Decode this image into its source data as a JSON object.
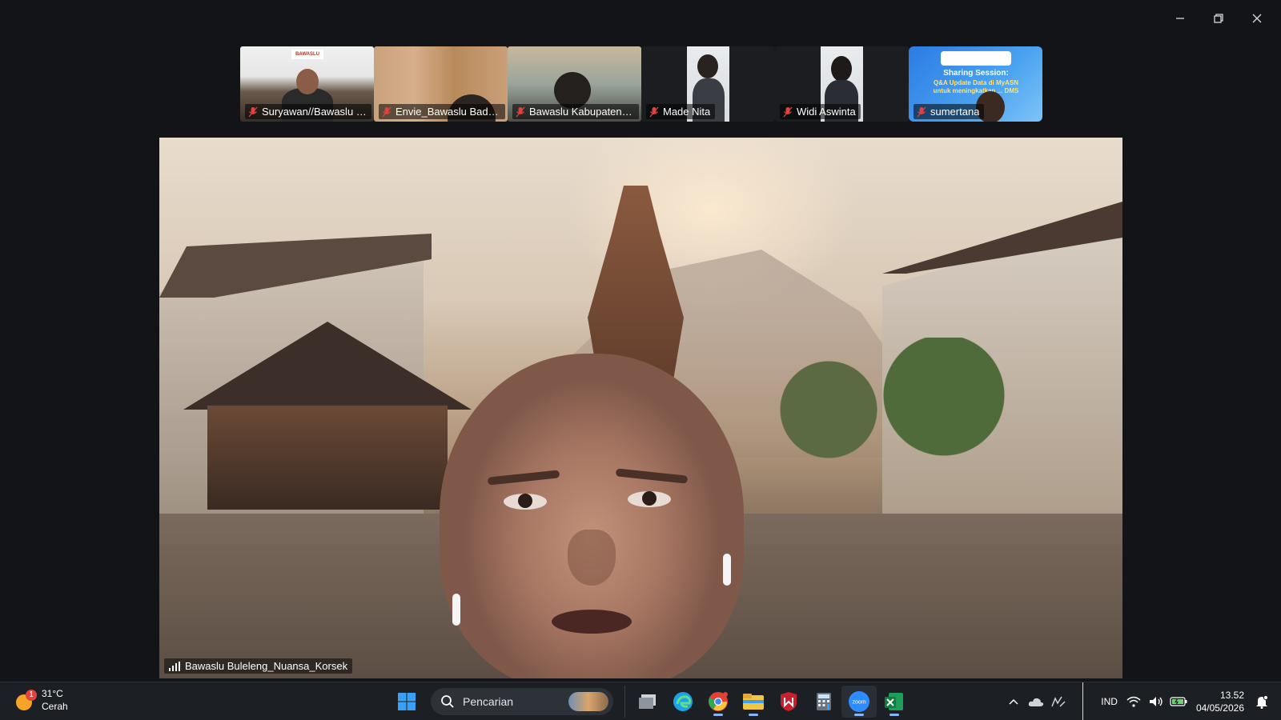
{
  "window": {
    "minimize_icon": "minimize-icon",
    "restore_icon": "restore-icon",
    "close_icon": "close-icon"
  },
  "participants": [
    {
      "name": "Suryawan//Bawaslu Ba...",
      "muted": true,
      "logo_text": "BAWASLU"
    },
    {
      "name": "Envie_Bawaslu Badung",
      "muted": true
    },
    {
      "name": "Bawaslu Kabupaten Gi...",
      "muted": true
    },
    {
      "name": "Made Nita",
      "muted": true
    },
    {
      "name": "Widi Aswinta",
      "muted": true
    },
    {
      "name": "sumertana",
      "muted": true,
      "banner_title": "Sharing Session:",
      "banner_sub": "Q&A Update Data di MyASN untuk meningkatkan ... DMS"
    }
  ],
  "main_speaker": {
    "name": "Bawaslu Buleleng_Nuansa_Korsek"
  },
  "taskbar": {
    "weather_temp": "31°C",
    "weather_desc": "Cerah",
    "weather_badge": "1",
    "search_placeholder": "Pencarian",
    "language": "IND",
    "time": "13.52",
    "date": "04/05/2026",
    "apps": [
      "windows-start",
      "task-view",
      "edge",
      "chrome",
      "file-explorer",
      "mcafee",
      "calculator",
      "zoom",
      "excel"
    ]
  },
  "colors": {
    "accent": "#2d8cff",
    "mute_red": "#e0433d"
  }
}
